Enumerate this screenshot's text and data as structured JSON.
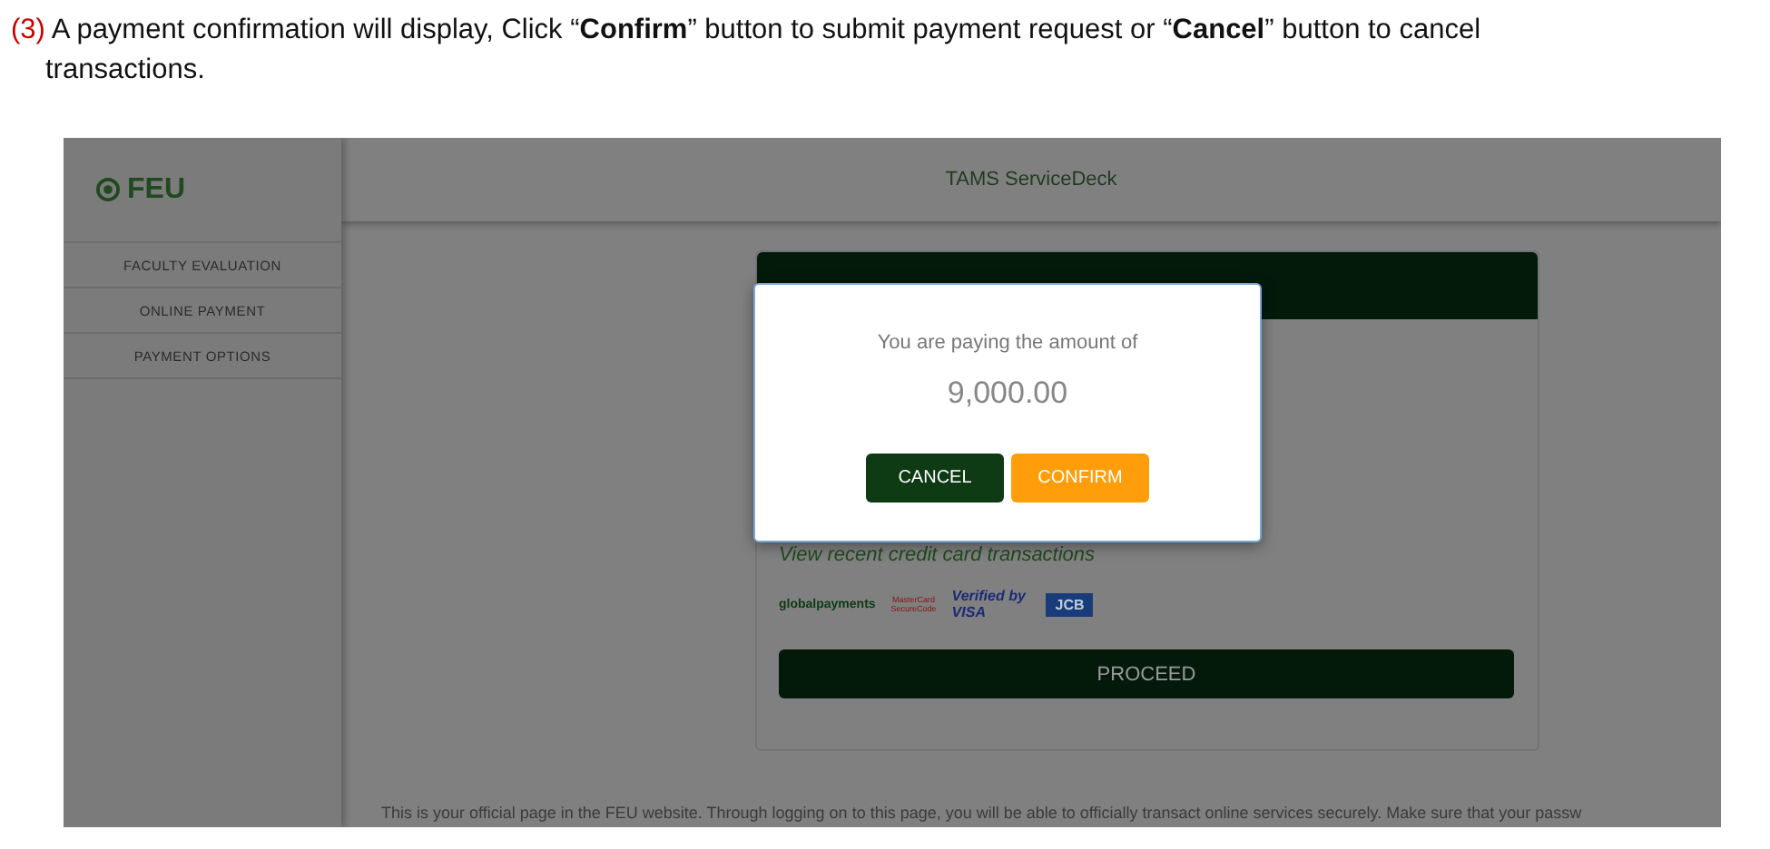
{
  "instruction": {
    "step": "(3)",
    "text": "A payment confirmation will display, Click “**Confirm**” button to submit payment request or “**Cancel**” button to cancel transactions."
  },
  "screenshot": {
    "logo": "FEU",
    "header_title": "TAMS ServiceDeck",
    "sidebar": {
      "items": [
        {
          "label": "FACULTY EVALUATION"
        },
        {
          "label": "ONLINE PAYMENT"
        },
        {
          "label": "PAYMENT OPTIONS"
        }
      ]
    },
    "card": {
      "link": "View recent credit card transactions",
      "logos": [
        {
          "kind": "global",
          "text": "globalpayments"
        },
        {
          "kind": "master",
          "text": "MasterCard SecureCode"
        },
        {
          "kind": "visa",
          "text": "Verified by VISA"
        },
        {
          "kind": "jcb",
          "text": "JCB"
        }
      ],
      "proceed": "PROCEED"
    },
    "footer_text": "This is your official page in the FEU website. Through logging on to this page, you will be able to officially transact online services securely. Make sure that your passw",
    "dialog": {
      "message": "You are paying the amount of",
      "amount": "9,000.00",
      "buttons": [
        {
          "kind": "cancel",
          "label": "CANCEL"
        },
        {
          "kind": "confirm",
          "label": "CONFIRM"
        }
      ]
    }
  }
}
